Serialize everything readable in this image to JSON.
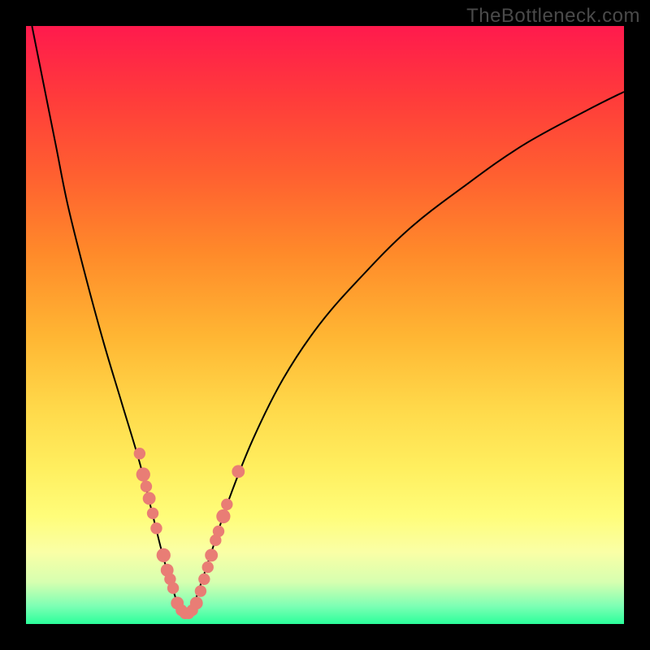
{
  "watermark": "TheBottleneck.com",
  "colors": {
    "frame": "#000000",
    "gradient_top": "#ff1a4d",
    "gradient_bottom": "#2bff9b",
    "curve": "#000000",
    "marker": "#e97d75"
  },
  "chart_data": {
    "type": "line",
    "title": "",
    "xlabel": "",
    "ylabel": "",
    "xlim": [
      0,
      100
    ],
    "ylim": [
      0,
      100
    ],
    "axes_visible": false,
    "grid": false,
    "series": [
      {
        "name": "bottleneck-curve",
        "x": [
          1,
          3,
          5,
          7,
          10,
          13,
          16,
          19,
          21,
          23,
          24.5,
          26,
          27.5,
          29,
          31,
          34,
          38,
          43,
          49,
          56,
          64,
          73,
          83,
          94,
          100
        ],
        "values": [
          100,
          90,
          80,
          70,
          58,
          47,
          37,
          27,
          19,
          11,
          6,
          2,
          2,
          6,
          12,
          21,
          31,
          41,
          50,
          58,
          66,
          73,
          80,
          86,
          89
        ]
      }
    ],
    "markers": [
      {
        "x": 19.0,
        "y": 28.5,
        "r": 1.0
      },
      {
        "x": 19.6,
        "y": 25.0,
        "r": 1.2
      },
      {
        "x": 20.1,
        "y": 23.0,
        "r": 1.0
      },
      {
        "x": 20.6,
        "y": 21.0,
        "r": 1.1
      },
      {
        "x": 21.2,
        "y": 18.5,
        "r": 1.0
      },
      {
        "x": 21.8,
        "y": 16.0,
        "r": 1.0
      },
      {
        "x": 23.0,
        "y": 11.5,
        "r": 1.2
      },
      {
        "x": 23.6,
        "y": 9.0,
        "r": 1.1
      },
      {
        "x": 24.1,
        "y": 7.5,
        "r": 1.0
      },
      {
        "x": 24.6,
        "y": 6.0,
        "r": 1.0
      },
      {
        "x": 25.3,
        "y": 3.5,
        "r": 1.1
      },
      {
        "x": 26.0,
        "y": 2.3,
        "r": 1.0
      },
      {
        "x": 26.6,
        "y": 1.8,
        "r": 1.0
      },
      {
        "x": 27.2,
        "y": 1.8,
        "r": 1.0
      },
      {
        "x": 27.8,
        "y": 2.3,
        "r": 1.0
      },
      {
        "x": 28.5,
        "y": 3.5,
        "r": 1.1
      },
      {
        "x": 29.2,
        "y": 5.5,
        "r": 1.0
      },
      {
        "x": 29.8,
        "y": 7.5,
        "r": 1.0
      },
      {
        "x": 30.4,
        "y": 9.5,
        "r": 1.0
      },
      {
        "x": 31.0,
        "y": 11.5,
        "r": 1.1
      },
      {
        "x": 31.7,
        "y": 14.0,
        "r": 1.0
      },
      {
        "x": 32.2,
        "y": 15.5,
        "r": 1.0
      },
      {
        "x": 33.0,
        "y": 18.0,
        "r": 1.2
      },
      {
        "x": 33.6,
        "y": 20.0,
        "r": 1.0
      },
      {
        "x": 35.5,
        "y": 25.5,
        "r": 1.1
      }
    ]
  }
}
